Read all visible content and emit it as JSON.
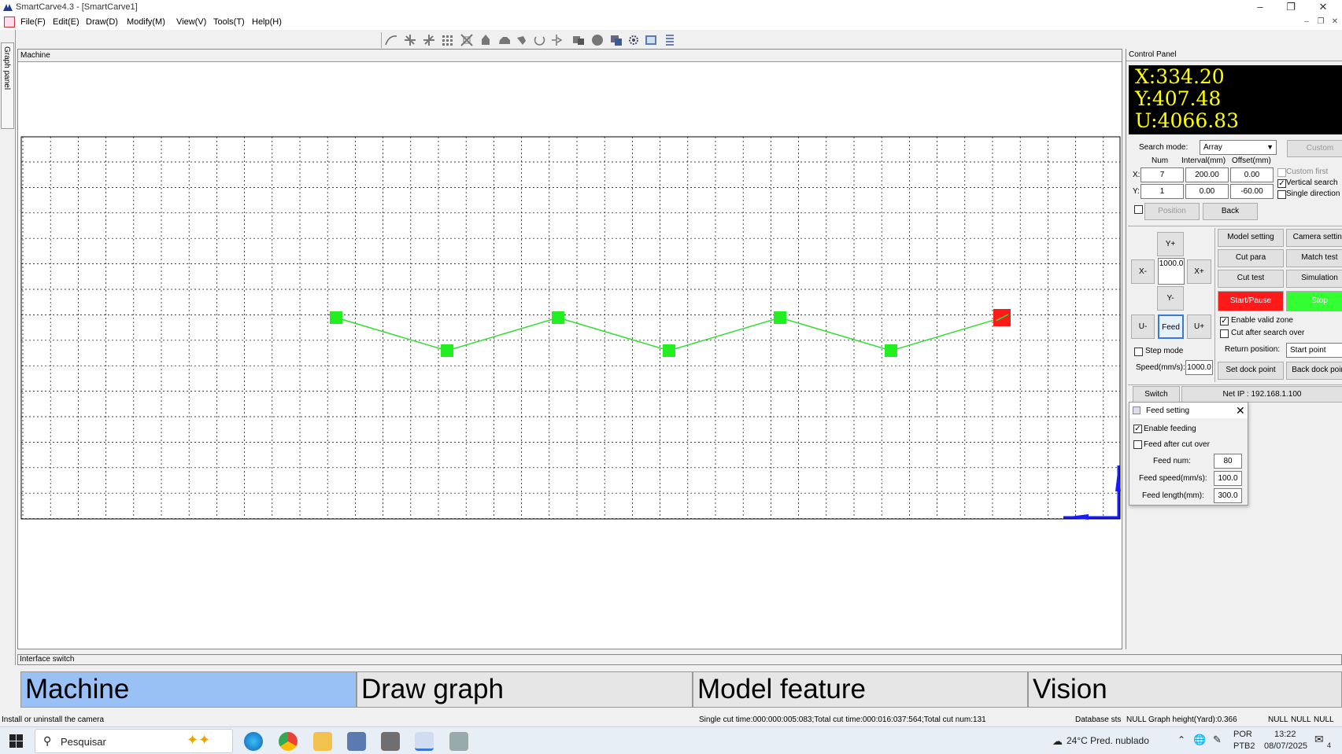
{
  "window": {
    "title": "SmartCarve4.3 - [SmartCarve1]"
  },
  "menu": [
    "File(F)",
    "Edit(E)",
    "Draw(D)",
    "Modify(M)",
    "View(V)",
    "Tools(T)",
    "Help(H)"
  ],
  "side": {
    "graph_panel": "Graph panel"
  },
  "machine": {
    "title": "Machine",
    "path_points": [
      [
        0,
        0
      ],
      [
        1,
        -1
      ],
      [
        2,
        0
      ],
      [
        3,
        -1
      ],
      [
        4,
        0
      ],
      [
        5,
        -1
      ],
      [
        6,
        0
      ]
    ],
    "active_point_index": 6
  },
  "control_panel": {
    "title": "Control Panel",
    "coords": {
      "x": "X:334.20",
      "y": "Y:407.48",
      "u": "U:4066.83"
    },
    "search_mode_label": "Search mode:",
    "search_mode_value": "Array",
    "custom_btn": "Custom",
    "col_num": "Num",
    "col_interval": "Interval(mm)",
    "col_offset": "Offset(mm)",
    "row_x": "X:",
    "row_y": "Y:",
    "x_num": "7",
    "x_interval": "200.00",
    "x_offset": "0.00",
    "y_num": "1",
    "y_interval": "0.00",
    "y_offset": "-60.00",
    "custom_first": "Custom first",
    "vertical_search": "Vertical search",
    "single_direction": "Single direction",
    "position_btn": "Position",
    "back_btn": "Back",
    "jog": {
      "y_plus": "Y+",
      "y_minus": "Y-",
      "x_minus": "X-",
      "x_plus": "X+",
      "step": "1000.0",
      "u_minus": "U-",
      "feed": "Feed",
      "u_plus": "U+"
    },
    "model_setting": "Model setting",
    "camera_setting": "Camera setting",
    "cut_para": "Cut para",
    "match_test": "Match test",
    "cut_test": "Cut test",
    "simulation": "Simulation",
    "start_pause": "Start/Pause",
    "stop": "Stop",
    "enable_valid_zone": "Enable valid zone",
    "cut_after_search_over": "Cut after search over",
    "return_position_label": "Return position:",
    "return_position_value": "Start point",
    "step_mode": "Step mode",
    "speed_label": "Speed(mm/s):",
    "speed_value": "1000.0",
    "set_dock_point": "Set dock point",
    "back_dock_point": "Back dock point",
    "switch_btn": "Switch",
    "net_ip": "Net IP : 192.168.1.100",
    "colors": {
      "start": "#ff1a1a",
      "stop": "#33ff33",
      "coords_text": "#ffff00"
    }
  },
  "feed_dialog": {
    "title": "Feed setting",
    "enable_feeding": "Enable feeding",
    "feed_after_cut_over": "Feed after cut over",
    "feed_num_label": "Feed num:",
    "feed_num": "80",
    "feed_speed_label": "Feed speed(mm/s):",
    "feed_speed": "100.0",
    "feed_length_label": "Feed length(mm):",
    "feed_length": "300.0"
  },
  "interface_switch": {
    "title": "Interface switch",
    "tabs": [
      "Machine",
      "Draw graph",
      "Model feature",
      "Vision"
    ]
  },
  "status": {
    "left": "Install or uninstall the camera",
    "middle": "Single cut time:000:000:005:083;Total cut time:000:016:037:564;Total cut num:131",
    "database": "Database sts",
    "graph_height": "NULL Graph height(Yard):0.366",
    "n1": "NULL",
    "n2": "NULL",
    "n3": "NULL"
  },
  "taskbar": {
    "search": "Pesquisar",
    "weather": "24°C  Pred. nublado",
    "lang1": "POR",
    "lang2": "PTB2",
    "time": "13:22",
    "date": "08/07/2025",
    "notif": "4"
  }
}
